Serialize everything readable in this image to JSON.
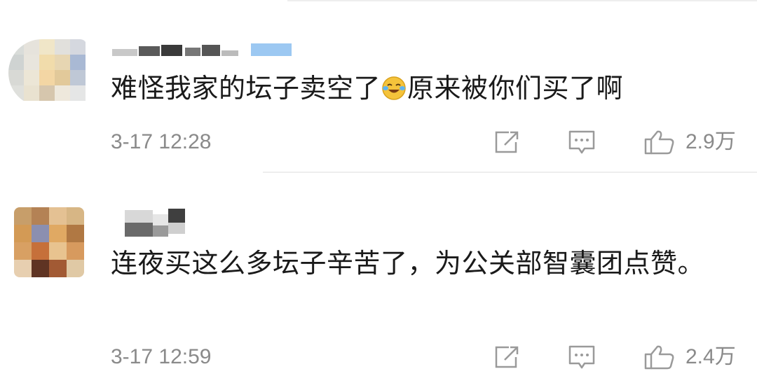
{
  "comments": [
    {
      "text_before": "难怪我家的坛子卖空了",
      "emoji": "laugh-cry-emoji",
      "text_after": "原来被你们买了啊",
      "timestamp": "3-17 12:28",
      "like_count": "2.9万"
    },
    {
      "text": "连夜买这么多坛子辛苦了，为公关部智囊团点赞。",
      "timestamp": "3-17 12:59",
      "like_count": "2.4万"
    }
  ],
  "colors": {
    "text": "#1a1a1a",
    "meta": "#8a8a8a",
    "icon": "#9a9a9a",
    "divider": "#eeeeee",
    "emoji_face": "#f5c33b"
  },
  "icons": [
    "share-icon",
    "reply-icon",
    "like-icon"
  ]
}
